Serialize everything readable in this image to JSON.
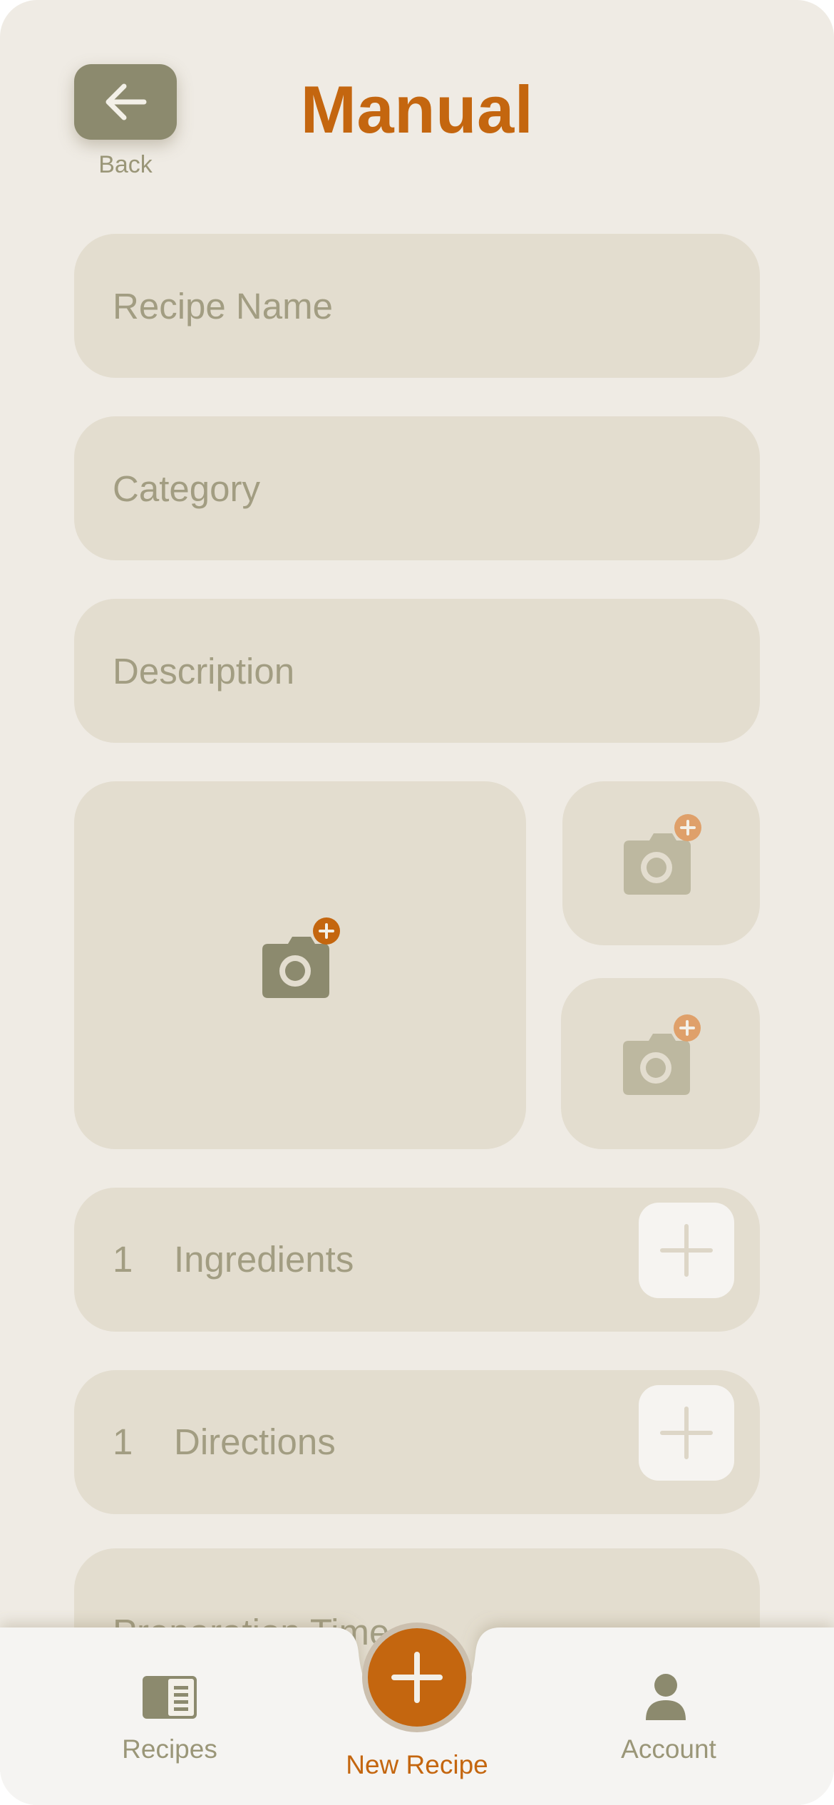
{
  "header": {
    "title": "Manual",
    "back_label": "Back"
  },
  "form": {
    "recipe_name_placeholder": "Recipe Name",
    "category_placeholder": "Category",
    "description_placeholder": "Description",
    "preparation_time_placeholder": "Preparation Time"
  },
  "lists": {
    "ingredients": {
      "count": "1",
      "label": "Ingredients"
    },
    "directions": {
      "count": "1",
      "label": "Directions"
    }
  },
  "tabbar": {
    "recipes_label": "Recipes",
    "new_recipe_label": "New Recipe",
    "account_label": "Account"
  },
  "colors": {
    "accent": "#c4660f",
    "olive": "#8c8a6e",
    "background": "#efebe4",
    "field": "#e3ddcf",
    "tabbar": "#f5f4f2"
  },
  "icons": {
    "back": "arrow-left-icon",
    "photo": "camera-plus-icon",
    "add": "plus-icon",
    "recipes": "recipe-book-icon",
    "new_recipe": "plus-icon",
    "account": "person-icon"
  }
}
